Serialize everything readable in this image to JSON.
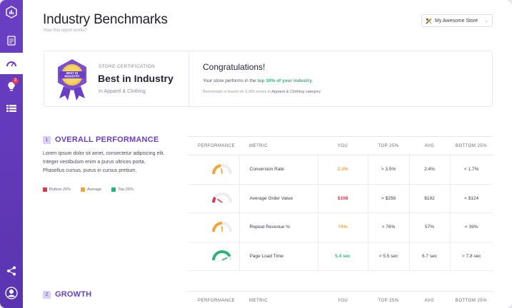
{
  "colors": {
    "brand": "#6a3fc4",
    "green": "#2bb574",
    "orange": "#f0a53a",
    "red": "#d43d4b"
  },
  "sidebar": {
    "items": [
      {
        "icon": "logo-icon"
      },
      {
        "icon": "report-icon"
      },
      {
        "icon": "speedometer-icon",
        "active": true
      },
      {
        "icon": "lightbulb-icon",
        "badge": "3"
      },
      {
        "icon": "list-icon"
      },
      {
        "icon": "share-icon"
      },
      {
        "icon": "user-avatar-icon"
      }
    ]
  },
  "header": {
    "title": "Industry Benchmarks",
    "subtitle": "How this report works?",
    "store_select": "My Awesome Store"
  },
  "certification": {
    "badge_text": "BEST IN INDUSTRY",
    "kicker": "STORE CERTIFICATION",
    "title": "Best in Industry",
    "subtitle": "In Apparel & Clothing",
    "congrats": "Congratulations!",
    "perform_prefix": "Your store performs in the ",
    "perform_highlight": "top 10% of your industry.",
    "bench_prefix": "Benchmark is based on 3,366 stores in ",
    "bench_bold": "Apparel & Clothing category."
  },
  "overall": {
    "number": "1",
    "title": "OVERALL PERFORMANCE",
    "description": "Lorem ipsum dolor sit amet, consectetur adipiscing elit. Integer vestibulum enim a purus ultrices porta. Phasellus cursus, purus in cursus pretium.",
    "legend": [
      {
        "label": "Bottom 25%",
        "color": "#d43d4b"
      },
      {
        "label": "Average",
        "color": "#f0a53a"
      },
      {
        "label": "Top 25%",
        "color": "#2bb574"
      }
    ]
  },
  "table": {
    "headers": [
      "PERFORMANCE",
      "METRIC",
      "YOU",
      "TOP 25%",
      "AVG",
      "BOTTOM 25%"
    ],
    "rows": [
      {
        "metric": "Conversion Rate",
        "you": "2.3%",
        "top": "> 3.5%",
        "avg": "2.4%",
        "bottom": "< 1.7%",
        "status": "average",
        "gauge": 0.45
      },
      {
        "metric": "Average Order Value",
        "you": "$108",
        "top": "> $256",
        "avg": "$192",
        "bottom": "< $124",
        "status": "bottom",
        "gauge": 0.2
      },
      {
        "metric": "Repeat Revenue %",
        "you": "74%",
        "top": "> 76%",
        "avg": "57%",
        "bottom": "< 39%",
        "status": "average",
        "gauge": 0.5
      },
      {
        "metric": "Page Load Time",
        "you": "5.4 sec",
        "top": "< 5.5 sec",
        "avg": "6.7 sec",
        "bottom": "> 7.8 sec",
        "status": "top",
        "gauge": 0.85
      }
    ]
  },
  "growth": {
    "number": "2",
    "title": "GROWTH",
    "headers": [
      "PERFORMANCE",
      "METRIC",
      "YOU",
      "TOP 25%",
      "AVG",
      "BOTTOM 25%"
    ]
  }
}
